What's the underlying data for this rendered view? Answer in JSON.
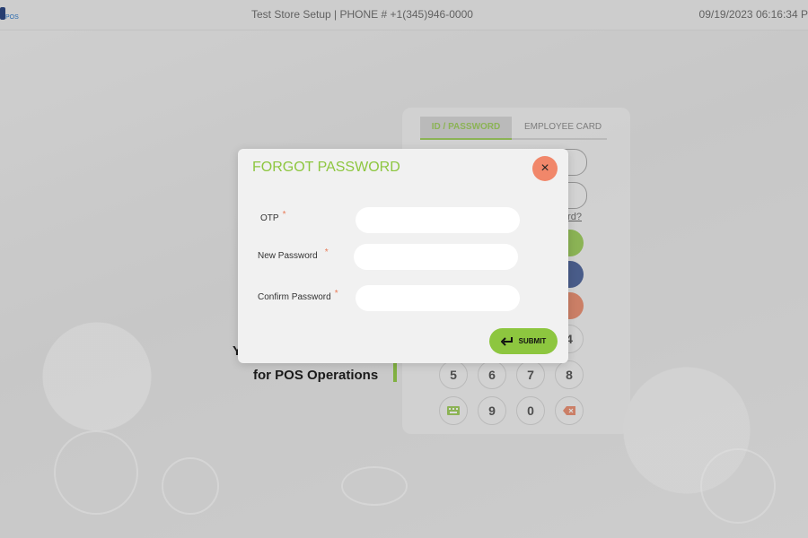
{
  "topbar": {
    "logo_text": "POS",
    "store_info": "Test Store Setup | PHONE # +1(345)946-0000",
    "datetime": "09/19/2023 06:16:34 P"
  },
  "login": {
    "tabs": [
      {
        "label": "ID / PASSWORD",
        "active": true
      },
      {
        "label": "EMPLOYEE CARD",
        "active": false
      }
    ],
    "forgot_link": "rd?",
    "keys": [
      "4",
      "5",
      "6",
      "7",
      "8",
      "9",
      "0"
    ],
    "action_colors": [
      "#8dc63f",
      "#2d4a8a",
      "#e87b58"
    ]
  },
  "tagline": {
    "line1_fragment": "Y",
    "line2": "for POS Operations"
  },
  "modal": {
    "title": "FORGOT PASSWORD",
    "fields": [
      {
        "label": "OTP",
        "value": "",
        "required": true
      },
      {
        "label": "New Password",
        "value": "",
        "required": true
      },
      {
        "label": "Confirm Password",
        "value": "",
        "required": true
      }
    ],
    "required_mark": "*",
    "submit_label": "SUBMIT",
    "close_icon": "×"
  },
  "colors": {
    "accent": "#8dc63f",
    "close": "#f1876a",
    "blue": "#2d4a8a"
  }
}
